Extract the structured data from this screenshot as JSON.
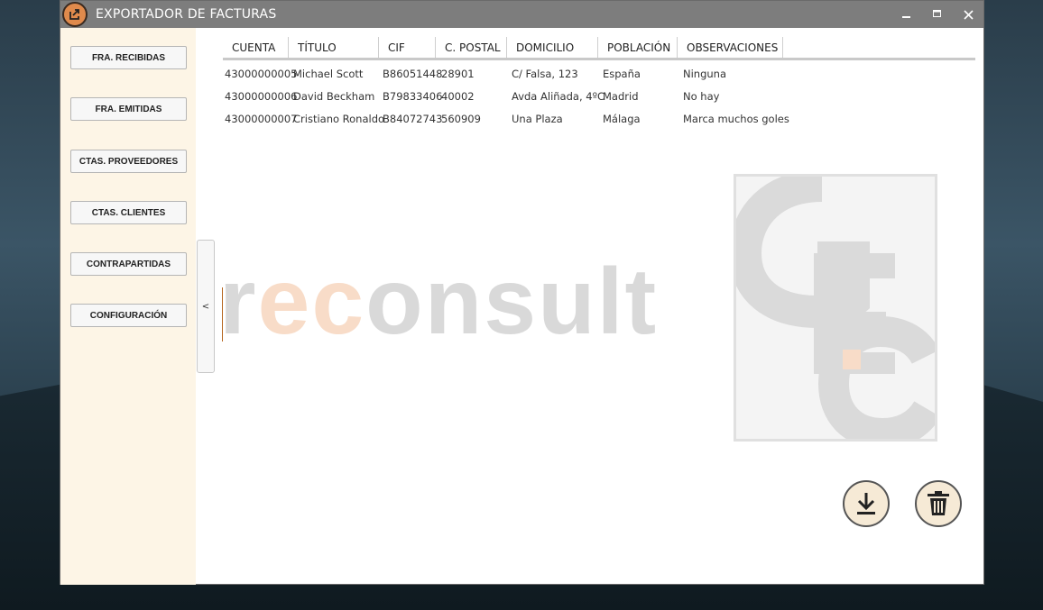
{
  "window": {
    "title": "EXPORTADOR DE FACTURAS"
  },
  "colors": {
    "accent": "#e08a4c",
    "sidebar_bg": "#fdf5e6",
    "titlebar": "#7d7d7d"
  },
  "sidebar": {
    "items": [
      {
        "label": "FRA. RECIBIDAS"
      },
      {
        "label": "FRA. EMITIDAS"
      },
      {
        "label": "CTAS. PROVEEDORES"
      },
      {
        "label": "CTAS. CLIENTES"
      },
      {
        "label": "CONTRAPARTIDAS"
      },
      {
        "label": "CONFIGURACIÓN"
      }
    ],
    "collapse_label": "<"
  },
  "table": {
    "headers": [
      "CUENTA",
      "TÍTULO",
      "CIF",
      "C. POSTAL",
      "DOMICILIO",
      "POBLACIÓN",
      "OBSERVACIONES"
    ],
    "rows": [
      [
        "43000000005",
        "Michael Scott",
        "B86051448",
        "28901",
        "C/ Falsa, 123",
        "España",
        "Ninguna"
      ],
      [
        "43000000006",
        "David Beckham",
        "B79833406",
        "40002",
        "Avda Aliñada, 4ºC",
        "Madrid",
        "No hay"
      ],
      [
        "43000000007",
        "Cristiano Ronaldo",
        "B84072743",
        "560909",
        "Una Plaza",
        "Málaga",
        "Marca muchos goles"
      ]
    ]
  },
  "watermark": {
    "brand_prefix": "r",
    "brand_accent": "ec",
    "brand_suffix": "onsult",
    "monogram": "GEC"
  },
  "actions": {
    "download_icon": "download-icon",
    "delete_icon": "trash-icon"
  }
}
